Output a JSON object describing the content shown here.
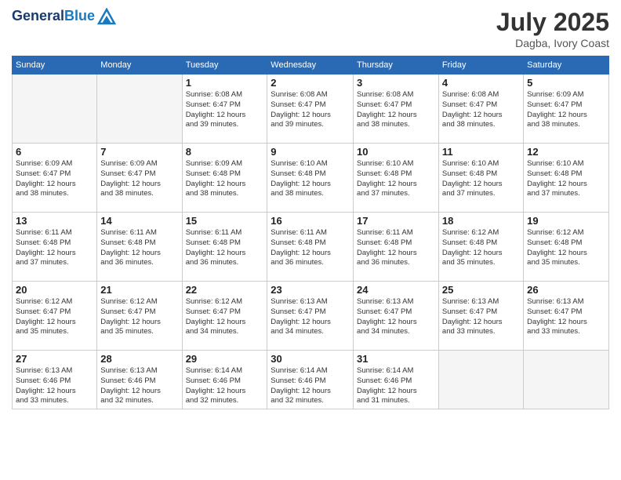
{
  "header": {
    "logo_line1": "General",
    "logo_line2": "Blue",
    "month_title": "July 2025",
    "location": "Dagba, Ivory Coast"
  },
  "weekdays": [
    "Sunday",
    "Monday",
    "Tuesday",
    "Wednesday",
    "Thursday",
    "Friday",
    "Saturday"
  ],
  "weeks": [
    [
      {
        "day": "",
        "detail": ""
      },
      {
        "day": "",
        "detail": ""
      },
      {
        "day": "1",
        "detail": "Sunrise: 6:08 AM\nSunset: 6:47 PM\nDaylight: 12 hours\nand 39 minutes."
      },
      {
        "day": "2",
        "detail": "Sunrise: 6:08 AM\nSunset: 6:47 PM\nDaylight: 12 hours\nand 39 minutes."
      },
      {
        "day": "3",
        "detail": "Sunrise: 6:08 AM\nSunset: 6:47 PM\nDaylight: 12 hours\nand 38 minutes."
      },
      {
        "day": "4",
        "detail": "Sunrise: 6:08 AM\nSunset: 6:47 PM\nDaylight: 12 hours\nand 38 minutes."
      },
      {
        "day": "5",
        "detail": "Sunrise: 6:09 AM\nSunset: 6:47 PM\nDaylight: 12 hours\nand 38 minutes."
      }
    ],
    [
      {
        "day": "6",
        "detail": "Sunrise: 6:09 AM\nSunset: 6:47 PM\nDaylight: 12 hours\nand 38 minutes."
      },
      {
        "day": "7",
        "detail": "Sunrise: 6:09 AM\nSunset: 6:47 PM\nDaylight: 12 hours\nand 38 minutes."
      },
      {
        "day": "8",
        "detail": "Sunrise: 6:09 AM\nSunset: 6:48 PM\nDaylight: 12 hours\nand 38 minutes."
      },
      {
        "day": "9",
        "detail": "Sunrise: 6:10 AM\nSunset: 6:48 PM\nDaylight: 12 hours\nand 38 minutes."
      },
      {
        "day": "10",
        "detail": "Sunrise: 6:10 AM\nSunset: 6:48 PM\nDaylight: 12 hours\nand 37 minutes."
      },
      {
        "day": "11",
        "detail": "Sunrise: 6:10 AM\nSunset: 6:48 PM\nDaylight: 12 hours\nand 37 minutes."
      },
      {
        "day": "12",
        "detail": "Sunrise: 6:10 AM\nSunset: 6:48 PM\nDaylight: 12 hours\nand 37 minutes."
      }
    ],
    [
      {
        "day": "13",
        "detail": "Sunrise: 6:11 AM\nSunset: 6:48 PM\nDaylight: 12 hours\nand 37 minutes."
      },
      {
        "day": "14",
        "detail": "Sunrise: 6:11 AM\nSunset: 6:48 PM\nDaylight: 12 hours\nand 36 minutes."
      },
      {
        "day": "15",
        "detail": "Sunrise: 6:11 AM\nSunset: 6:48 PM\nDaylight: 12 hours\nand 36 minutes."
      },
      {
        "day": "16",
        "detail": "Sunrise: 6:11 AM\nSunset: 6:48 PM\nDaylight: 12 hours\nand 36 minutes."
      },
      {
        "day": "17",
        "detail": "Sunrise: 6:11 AM\nSunset: 6:48 PM\nDaylight: 12 hours\nand 36 minutes."
      },
      {
        "day": "18",
        "detail": "Sunrise: 6:12 AM\nSunset: 6:48 PM\nDaylight: 12 hours\nand 35 minutes."
      },
      {
        "day": "19",
        "detail": "Sunrise: 6:12 AM\nSunset: 6:48 PM\nDaylight: 12 hours\nand 35 minutes."
      }
    ],
    [
      {
        "day": "20",
        "detail": "Sunrise: 6:12 AM\nSunset: 6:47 PM\nDaylight: 12 hours\nand 35 minutes."
      },
      {
        "day": "21",
        "detail": "Sunrise: 6:12 AM\nSunset: 6:47 PM\nDaylight: 12 hours\nand 35 minutes."
      },
      {
        "day": "22",
        "detail": "Sunrise: 6:12 AM\nSunset: 6:47 PM\nDaylight: 12 hours\nand 34 minutes."
      },
      {
        "day": "23",
        "detail": "Sunrise: 6:13 AM\nSunset: 6:47 PM\nDaylight: 12 hours\nand 34 minutes."
      },
      {
        "day": "24",
        "detail": "Sunrise: 6:13 AM\nSunset: 6:47 PM\nDaylight: 12 hours\nand 34 minutes."
      },
      {
        "day": "25",
        "detail": "Sunrise: 6:13 AM\nSunset: 6:47 PM\nDaylight: 12 hours\nand 33 minutes."
      },
      {
        "day": "26",
        "detail": "Sunrise: 6:13 AM\nSunset: 6:47 PM\nDaylight: 12 hours\nand 33 minutes."
      }
    ],
    [
      {
        "day": "27",
        "detail": "Sunrise: 6:13 AM\nSunset: 6:46 PM\nDaylight: 12 hours\nand 33 minutes."
      },
      {
        "day": "28",
        "detail": "Sunrise: 6:13 AM\nSunset: 6:46 PM\nDaylight: 12 hours\nand 32 minutes."
      },
      {
        "day": "29",
        "detail": "Sunrise: 6:14 AM\nSunset: 6:46 PM\nDaylight: 12 hours\nand 32 minutes."
      },
      {
        "day": "30",
        "detail": "Sunrise: 6:14 AM\nSunset: 6:46 PM\nDaylight: 12 hours\nand 32 minutes."
      },
      {
        "day": "31",
        "detail": "Sunrise: 6:14 AM\nSunset: 6:46 PM\nDaylight: 12 hours\nand 31 minutes."
      },
      {
        "day": "",
        "detail": ""
      },
      {
        "day": "",
        "detail": ""
      }
    ]
  ]
}
